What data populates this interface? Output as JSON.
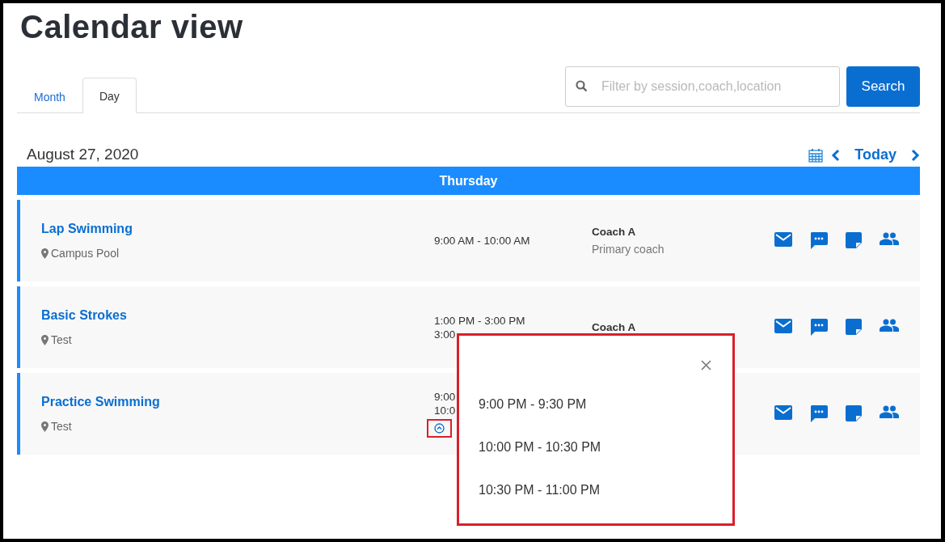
{
  "title": "Calendar view",
  "tabs": [
    {
      "label": "Month",
      "selected": false
    },
    {
      "label": "Day",
      "selected": true
    }
  ],
  "search": {
    "placeholder": "Filter by session,coach,location",
    "button": "Search"
  },
  "date": "August 27, 2020",
  "nav": {
    "today": "Today"
  },
  "day_header": "Thursday",
  "sessions": [
    {
      "name": "Lap Swimming",
      "location": "Campus Pool",
      "times": [
        "9:00 AM - 10:00 AM"
      ],
      "coach": "Coach A",
      "coach_role": "Primary coach"
    },
    {
      "name": "Basic Strokes",
      "location": "Test",
      "times": [
        "1:00 PM - 3:00 PM",
        "3:00"
      ],
      "coach": "Coach A"
    },
    {
      "name": "Practice Swimming",
      "location": "Test",
      "times": [
        "9:00",
        "10:0"
      ],
      "expanded": true
    }
  ],
  "popup": {
    "times": [
      "9:00 PM - 9:30 PM",
      "10:00 PM - 10:30 PM",
      "10:30 PM - 11:00 PM"
    ]
  }
}
